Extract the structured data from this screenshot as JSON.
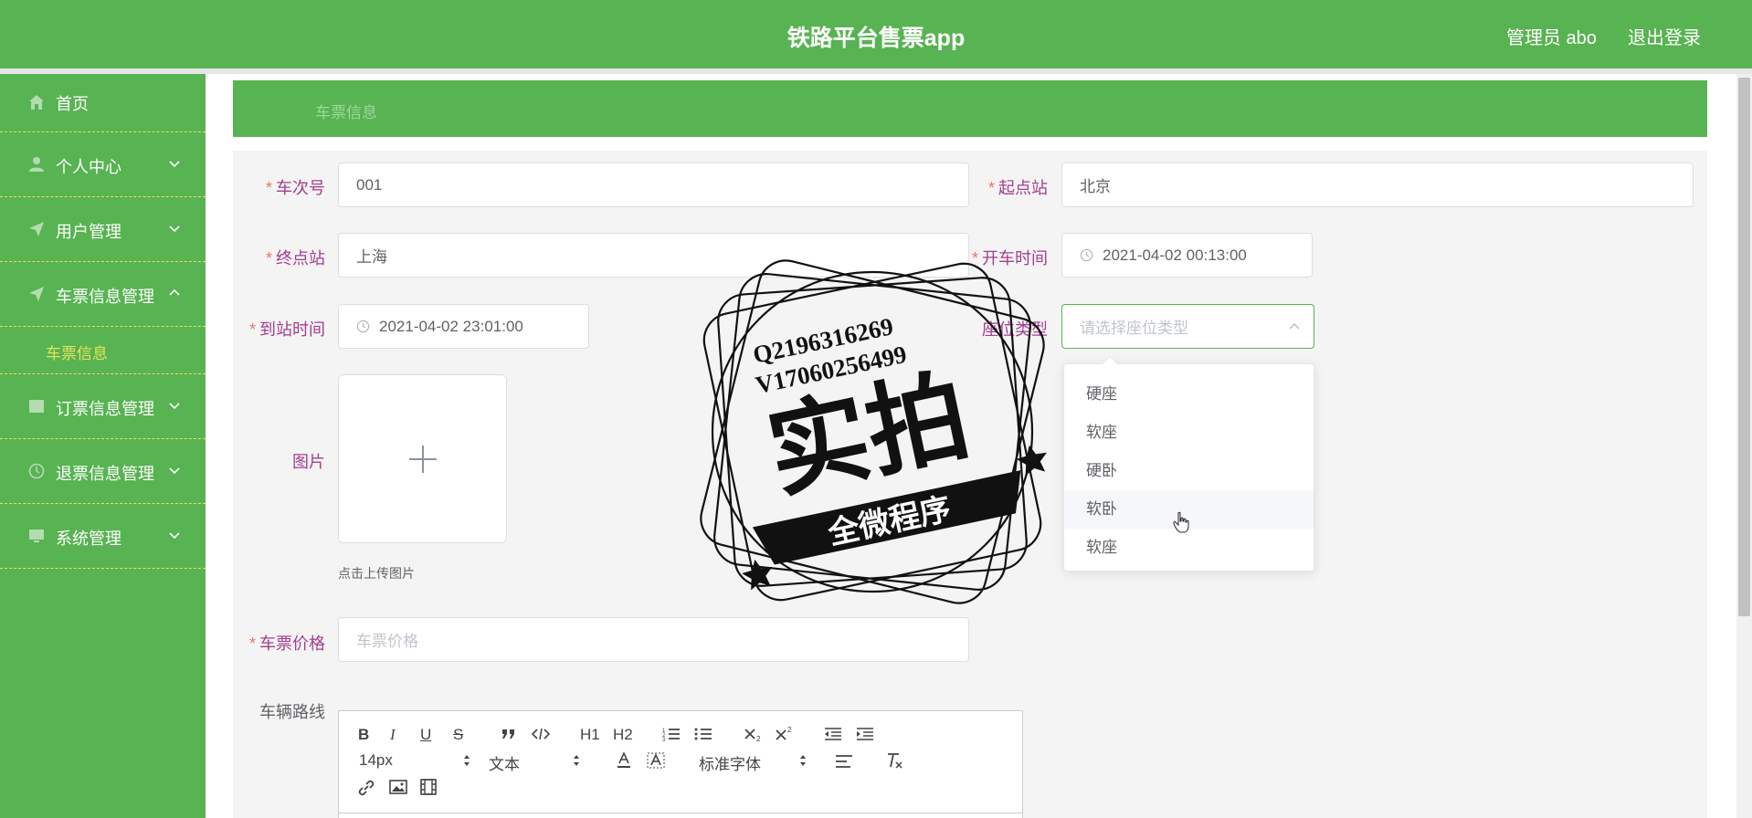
{
  "header": {
    "title": "铁路平台售票app",
    "admin": "管理员 abo",
    "logout": "退出登录"
  },
  "sidebar": {
    "items": [
      {
        "label": "首页",
        "icon": "home-icon"
      },
      {
        "label": "个人中心",
        "icon": "user-icon"
      },
      {
        "label": "用户管理",
        "icon": "send-icon"
      },
      {
        "label": "车票信息管理",
        "icon": "send-icon",
        "expanded": true
      },
      {
        "label": "订票信息管理",
        "icon": "grid-icon"
      },
      {
        "label": "退票信息管理",
        "icon": "clock-icon"
      },
      {
        "label": "系统管理",
        "icon": "monitor-icon"
      }
    ],
    "subitem": "车票信息"
  },
  "breadcrumb": "车票信息",
  "form": {
    "train_no": {
      "label": "车次号",
      "value": "001"
    },
    "start_station": {
      "label": "起点站",
      "value": "北京"
    },
    "end_station": {
      "label": "终点站",
      "value": "上海"
    },
    "depart_time": {
      "label": "开车时间",
      "value": "2021-04-02 00:13:00"
    },
    "arrive_time": {
      "label": "到站时间",
      "value": "2021-04-02 23:01:00"
    },
    "seat_type": {
      "label": "座位类型",
      "placeholder": "请选择座位类型"
    },
    "image": {
      "label": "图片",
      "tip": "点击上传图片"
    },
    "price": {
      "label": "车票价格",
      "placeholder": "车票价格"
    },
    "route": {
      "label": "车辆路线"
    }
  },
  "seat_options": [
    "硬座",
    "软座",
    "硬卧",
    "软卧",
    "软座"
  ],
  "editor": {
    "font_size": "14px",
    "text_type": "文本",
    "font_family": "标准字体",
    "buttons": {
      "bold": "B",
      "italic": "I",
      "underline": "U",
      "strike": "S",
      "h1": "H1",
      "h2": "H2"
    }
  },
  "watermark": {
    "line1": "Q2196316269",
    "line2": "V17060256499",
    "main": "实拍",
    "banner": "全微程序"
  },
  "colors": {
    "brand_green": "#58b352",
    "sidebar_highlight": "#e6e35a",
    "label_purple": "#a43d8e",
    "required_red": "#f56c6c"
  }
}
